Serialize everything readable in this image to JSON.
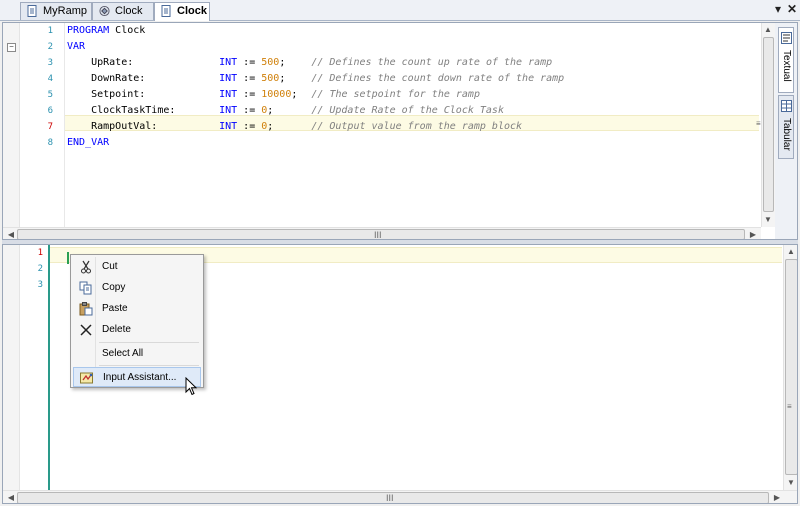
{
  "tabs": [
    {
      "label": "MyRamp",
      "icon": "document-icon",
      "active": false
    },
    {
      "label": "Clock",
      "icon": "pou-icon",
      "active": false
    },
    {
      "label": "Clock",
      "icon": "document-icon",
      "active": true
    }
  ],
  "tab_controls": {
    "dropdown": "▾",
    "close": "✕"
  },
  "declaration": {
    "line_numbers": [
      "1",
      "2",
      "3",
      "4",
      "5",
      "6",
      "7",
      "8"
    ],
    "lines": [
      {
        "indent": "",
        "keyword": "PROGRAM",
        "name": " Clock",
        "type": "",
        "assign": "",
        "value": "",
        "end": "",
        "comment": ""
      },
      {
        "indent": "",
        "keyword": "VAR",
        "name": "",
        "type": "",
        "assign": "",
        "value": "",
        "end": "",
        "comment": ""
      },
      {
        "indent": "    ",
        "keyword": "",
        "name": "UpRate:",
        "type": "INT",
        "assign": " := ",
        "value": "500",
        "end": ";",
        "comment": "// Defines the count up rate of the ramp"
      },
      {
        "indent": "    ",
        "keyword": "",
        "name": "DownRate:",
        "type": "INT",
        "assign": " := ",
        "value": "500",
        "end": ";",
        "comment": "// Defines the count down rate of the ramp"
      },
      {
        "indent": "    ",
        "keyword": "",
        "name": "Setpoint:",
        "type": "INT",
        "assign": " := ",
        "value": "10000",
        "end": ";",
        "comment": "// The setpoint for the ramp"
      },
      {
        "indent": "    ",
        "keyword": "",
        "name": "ClockTaskTime:",
        "type": "INT",
        "assign": " := ",
        "value": "0",
        "end": ";",
        "comment": "// Update Rate of the Clock Task"
      },
      {
        "indent": "    ",
        "keyword": "",
        "name": "RampOutVal:",
        "type": "INT",
        "assign": " := ",
        "value": "0",
        "end": ";",
        "comment": "// Output value from the ramp block"
      },
      {
        "indent": "",
        "keyword": "END_VAR",
        "name": "",
        "type": "",
        "assign": "",
        "value": "",
        "end": "",
        "comment": ""
      }
    ]
  },
  "side_tabs": [
    {
      "label": "Textual",
      "icon": "textual-view-icon",
      "active": true
    },
    {
      "label": "Tabular",
      "icon": "table-view-icon",
      "active": false
    }
  ],
  "implementation": {
    "line_numbers": [
      "1",
      "2",
      "3"
    ]
  },
  "scroll_grip": "III",
  "context_menu": {
    "items": [
      {
        "label": "Cut",
        "icon": "scissors-icon"
      },
      {
        "label": "Copy",
        "icon": "copy-icon"
      },
      {
        "label": "Paste",
        "icon": "paste-icon"
      },
      {
        "label": "Delete",
        "icon": "delete-x-icon"
      },
      {
        "label": "Select All",
        "icon": ""
      },
      {
        "label": "Input Assistant...",
        "icon": "input-assistant-icon",
        "highlighted": true
      }
    ]
  },
  "colors": {
    "keyword": "#0000ff",
    "number": "#d0800a",
    "comment": "#808080",
    "line_number": "#2b91af",
    "current_line": "#fdfbe4",
    "caret": "#2aa052"
  }
}
